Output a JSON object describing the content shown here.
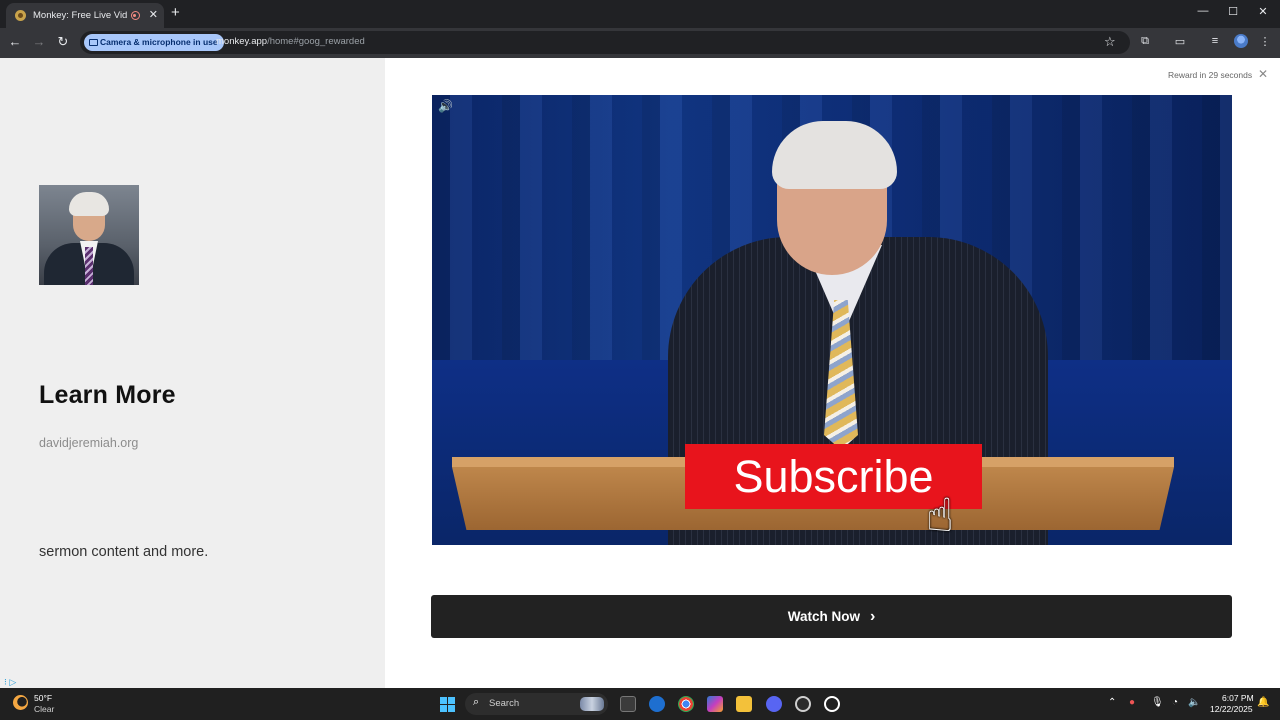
{
  "browser": {
    "tab_title": "Monkey: Free Live Video Ch",
    "tab_close": "✕",
    "new_tab": "+",
    "window_controls": {
      "minimize": "—",
      "maximize": "☐",
      "close": "✕"
    },
    "permission_pill": "Camera & microphone in use",
    "url_host": "monkey.app",
    "url_path": "/home#goog_rewarded"
  },
  "ad": {
    "reward_text": "Reward in 29 seconds",
    "close": "✕",
    "headline": "Learn More",
    "domain": "davidjeremiah.org",
    "description": "sermon content and more.",
    "adchoices": "⁝ ▷",
    "video": {
      "overlay_text": "Subscribe",
      "volume_icon": "🔊",
      "hand_icon": "☝"
    },
    "cta_label": "Watch Now",
    "cta_chevron": "›"
  },
  "taskbar": {
    "weather_temp": "50°F",
    "weather_condition": "Clear",
    "search_label": "Search",
    "clock_time": "6:07 PM",
    "clock_date": "12/22/2025"
  },
  "colors": {
    "cta_background": "#222222",
    "subscribe_red": "#e8141c",
    "permission_blue": "#a8c7fa"
  }
}
